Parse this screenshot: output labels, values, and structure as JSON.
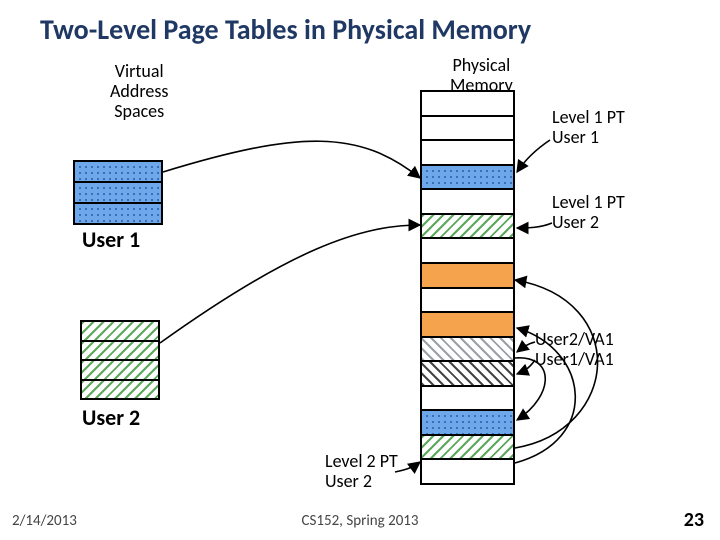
{
  "title": "Two-Level Page Tables in Physical Memory",
  "vas_label": "Virtual\nAddress\nSpaces",
  "phys_label": "Physical\nMemory",
  "l1pt_user1": "Level 1 PT\nUser 1",
  "l1pt_user2": "Level 1 PT\nUser 2",
  "u2va1": "User2/VA1",
  "u1va1": "User1/VA1",
  "l2pt_user2": "Level 2 PT\nUser 2",
  "va1_a": "VA1",
  "va1_b": "VA1",
  "user1": "User 1",
  "user2": "User 2",
  "footer": {
    "date": "2/14/2013",
    "course": "CS152, Spring 2013",
    "slide": "23"
  }
}
